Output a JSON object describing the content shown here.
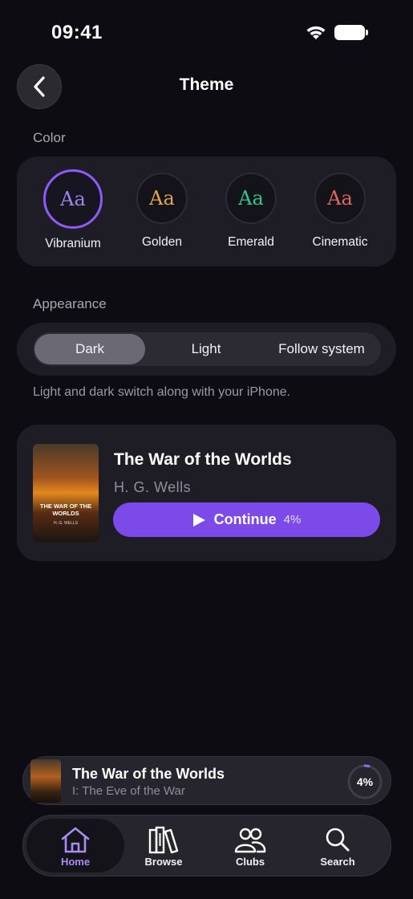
{
  "status_bar": {
    "time": "09:41"
  },
  "header": {
    "title": "Theme"
  },
  "color_section": {
    "label": "Color",
    "options": [
      {
        "sample": "Aa",
        "name": "Vibranium",
        "color": "#9b87e8",
        "selected": true
      },
      {
        "sample": "Aa",
        "name": "Golden",
        "color": "#e0a84a",
        "selected": false
      },
      {
        "sample": "Aa",
        "name": "Emerald",
        "color": "#35c48e",
        "selected": false
      },
      {
        "sample": "Aa",
        "name": "Cinematic",
        "color": "#e2665f",
        "selected": false
      }
    ],
    "accent": "#8b5cf6"
  },
  "appearance_section": {
    "label": "Appearance",
    "options": [
      "Dark",
      "Light",
      "Follow system"
    ],
    "selected": "Dark",
    "helper": "Light and dark switch along with your iPhone."
  },
  "book_card": {
    "title": "The War of the Worlds",
    "author": "H. G. Wells",
    "cover_title": "THE WAR OF THE WORLDS",
    "cover_author": "H. G. WELLS",
    "continue_label": "Continue",
    "progress": "4%"
  },
  "mini_player": {
    "title": "The War of the Worlds",
    "chapter": "I: The Eve of the War",
    "progress": "4%",
    "progress_value": 0.04
  },
  "tab_bar": {
    "tabs": [
      {
        "label": "Home",
        "icon": "home-icon",
        "active": true
      },
      {
        "label": "Browse",
        "icon": "books-icon",
        "active": false
      },
      {
        "label": "Clubs",
        "icon": "people-icon",
        "active": false
      },
      {
        "label": "Search",
        "icon": "search-icon",
        "active": false
      }
    ]
  }
}
